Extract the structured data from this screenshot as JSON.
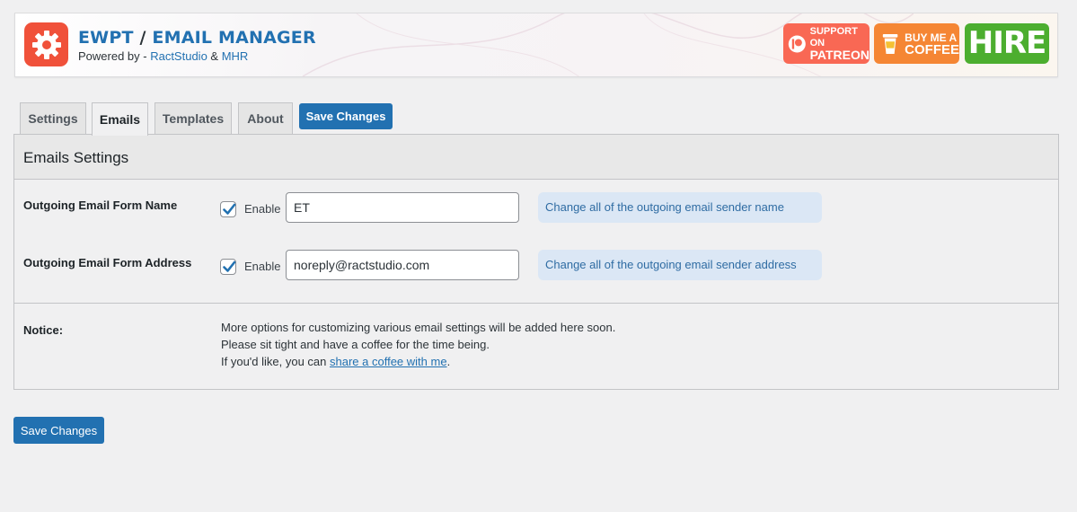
{
  "header": {
    "title_part1": "EWPT",
    "title_sep": " / ",
    "title_part2": "EMAIL MANAGER",
    "powered_prefix": "Powered by - ",
    "powered_link1": "RactStudio",
    "powered_amp": " & ",
    "powered_link2": "MHR",
    "logo_icon": "gear-icon",
    "patreon": {
      "line1": "SUPPORT ON",
      "line2": "PATREON",
      "color": "#f96854"
    },
    "coffee": {
      "line1": "BUY ME A",
      "line2": "COFFEE",
      "color": "#f58634"
    },
    "hire": {
      "label": "HIRE",
      "color": "#4cae2f"
    }
  },
  "tabs": [
    {
      "label": "Settings",
      "active": false
    },
    {
      "label": "Emails",
      "active": true
    },
    {
      "label": "Templates",
      "active": false
    },
    {
      "label": "About",
      "active": false
    }
  ],
  "save_label": "Save Changes",
  "panel": {
    "title": "Emails Settings",
    "rows": [
      {
        "label": "Outgoing Email Form Name",
        "checked": true,
        "enable_label": "Enable",
        "value": "ET",
        "hint": "Change all of the outgoing email sender name"
      },
      {
        "label": "Outgoing Email Form Address",
        "checked": true,
        "enable_label": "Enable",
        "value": "noreply@ractstudio.com",
        "hint": "Change all of the outgoing email sender address"
      }
    ],
    "notice": {
      "label": "Notice:",
      "line1": "More options for customizing various email settings will be added here soon.",
      "line2": "Please sit tight and have a coffee for the time being.",
      "line3_prefix": "If you'd like, you can ",
      "line3_link": "share a coffee with me",
      "line3_suffix": "."
    }
  },
  "colors": {
    "primary": "#2271b1",
    "hint_bg": "#dbe7f5",
    "logo_bg": "#f0513a"
  }
}
